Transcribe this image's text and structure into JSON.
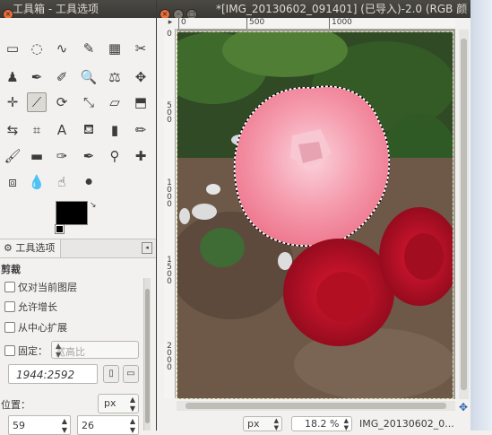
{
  "toolbox": {
    "title": "工具箱 - 工具选项",
    "tools": [
      {
        "name": "rect-select-icon",
        "glyph": "▭"
      },
      {
        "name": "ellipse-select-icon",
        "glyph": "◌"
      },
      {
        "name": "free-select-icon",
        "glyph": "∿"
      },
      {
        "name": "fuzzy-select-icon",
        "glyph": "✎"
      },
      {
        "name": "color-select-icon",
        "glyph": "▦"
      },
      {
        "name": "scissors-select-icon",
        "glyph": "✂"
      },
      {
        "name": "foreground-select-icon",
        "glyph": "♟"
      },
      {
        "name": "paths-icon",
        "glyph": "✒"
      },
      {
        "name": "color-picker-icon",
        "glyph": "✐"
      },
      {
        "name": "zoom-icon",
        "glyph": "🔍"
      },
      {
        "name": "measure-icon",
        "glyph": "⚖"
      },
      {
        "name": "move-icon",
        "glyph": "✥"
      },
      {
        "name": "align-icon",
        "glyph": "✛"
      },
      {
        "name": "crop-icon",
        "glyph": "⟋"
      },
      {
        "name": "rotate-icon",
        "glyph": "⟳"
      },
      {
        "name": "scale-icon",
        "glyph": "⤡"
      },
      {
        "name": "shear-icon",
        "glyph": "▱"
      },
      {
        "name": "perspective-icon",
        "glyph": "⬒"
      },
      {
        "name": "flip-icon",
        "glyph": "⇆"
      },
      {
        "name": "cage-icon",
        "glyph": "⌗"
      },
      {
        "name": "text-icon",
        "glyph": "A"
      },
      {
        "name": "bucket-fill-icon",
        "glyph": "⛾"
      },
      {
        "name": "blend-icon",
        "glyph": "▮"
      },
      {
        "name": "pencil-icon",
        "glyph": "✏"
      },
      {
        "name": "paintbrush-icon",
        "glyph": "🖌"
      },
      {
        "name": "eraser-icon",
        "glyph": "▬"
      },
      {
        "name": "airbrush-icon",
        "glyph": "✑"
      },
      {
        "name": "ink-icon",
        "glyph": "✒"
      },
      {
        "name": "clone-icon",
        "glyph": "⚲"
      },
      {
        "name": "heal-icon",
        "glyph": "✚"
      },
      {
        "name": "perspective-clone-icon",
        "glyph": "⧈"
      },
      {
        "name": "blur-icon",
        "glyph": "💧"
      },
      {
        "name": "smudge-icon",
        "glyph": "☝"
      },
      {
        "name": "dodge-burn-icon",
        "glyph": "⚫"
      }
    ],
    "tab_label": "工具选项",
    "options_title": "剪裁",
    "option_current_layer": "仅对当前图层",
    "option_allow_grow": "允许增长",
    "option_expand_center": "从中心扩展",
    "fixed_label": "固定：",
    "fixed_mode": "宽高比",
    "ratio_value": "1944:2592",
    "position_label": "位置：",
    "position_unit": "px",
    "position_x": "59",
    "position_y": "26"
  },
  "image_window": {
    "title": "*[IMG_20130602_091401] (已导入)-2.0 (RGB 颜",
    "ruler_h": [
      "0",
      "500",
      "1000"
    ],
    "ruler_v": [
      "0",
      "500",
      "1000",
      "1500",
      "2000"
    ],
    "status_unit": "px",
    "zoom": "18.2 %",
    "file_label": "IMG_20130602_0..."
  }
}
